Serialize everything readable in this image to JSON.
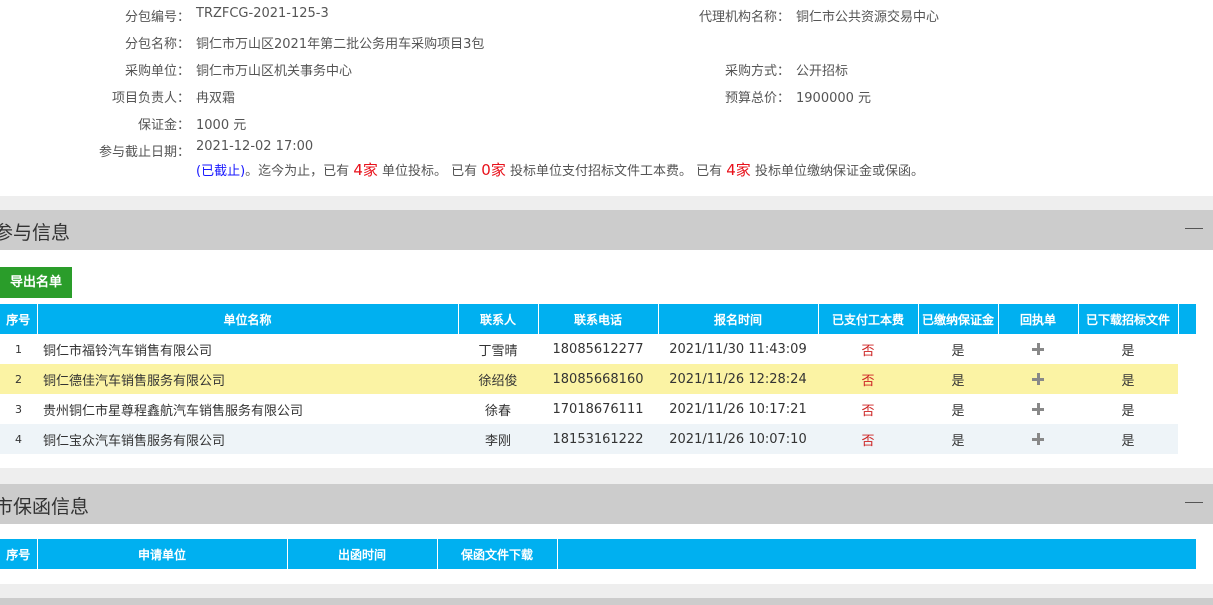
{
  "package_info": {
    "package_no_label": "分包编号：",
    "package_no": "TRZFCG-2021-125-3",
    "agency_label": "代理机构名称：",
    "agency": "铜仁市公共资源交易中心",
    "package_name_label": "分包名称：",
    "package_name": "铜仁市万山区2021年第二批公务用车采购项目3包",
    "purchaser_label": "采购单位：",
    "purchaser": "铜仁市万山区机关事务中心",
    "method_label": "采购方式：",
    "method": "公开招标",
    "manager_label": "项目负责人：",
    "manager": "冉双霜",
    "budget_label": "预算总价：",
    "budget": "1900000 元",
    "deposit_label": "保证金：",
    "deposit": "1000 元",
    "deadline_label": "参与截止日期：",
    "deadline": "2021-12-02 17:00",
    "deadline_status": "(已截止)",
    "stats_text_1": "。迄今为止，已有",
    "bid_count": "4家",
    "stats_text_2": "单位投标。 已有",
    "fee_paid_count": "0家",
    "stats_text_3": "投标单位支付招标文件工本费。 已有",
    "deposit_paid_count": "4家",
    "stats_text_4": "投标单位缴纳保证金或保函。"
  },
  "participants": {
    "title": "参与信息",
    "export_label": "导出名单",
    "columns": [
      "序号",
      "单位名称",
      "联系人",
      "联系电话",
      "报名时间",
      "已支付工本费",
      "已缴纳保证金",
      "回执单",
      "已下载招标文件"
    ],
    "rows": [
      {
        "idx": "1",
        "name": "铜仁市福铃汽车销售有限公司",
        "contact": "丁雪晴",
        "phone": "18085612277",
        "time": "2021/11/30 11:43:09",
        "fee_paid": "否",
        "deposit_paid": "是",
        "downloaded": "是"
      },
      {
        "idx": "2",
        "name": "铜仁德佳汽车销售服务有限公司",
        "contact": "徐绍俊",
        "phone": "18085668160",
        "time": "2021/11/26 12:28:24",
        "fee_paid": "否",
        "deposit_paid": "是",
        "downloaded": "是"
      },
      {
        "idx": "3",
        "name": "贵州铜仁市星尊程鑫航汽车销售服务有限公司",
        "contact": "徐春",
        "phone": "17018676111",
        "time": "2021/11/26 10:17:21",
        "fee_paid": "否",
        "deposit_paid": "是",
        "downloaded": "是"
      },
      {
        "idx": "4",
        "name": "铜仁宝众汽车销售服务有限公司",
        "contact": "李刚",
        "phone": "18153161222",
        "time": "2021/11/26 10:07:10",
        "fee_paid": "否",
        "deposit_paid": "是",
        "downloaded": "是"
      }
    ]
  },
  "guarantees": {
    "title": "市保函信息",
    "columns": [
      "序号",
      "申请单位",
      "出函时间",
      "保函文件下载"
    ]
  },
  "colors": {
    "table_header": "#00b0f0",
    "section_header": "#cccccc",
    "export_button": "#2a9d2a",
    "highlight_row": "#fbf3a4",
    "count_red": "#e8101a",
    "closed_blue": "#1a1aff"
  },
  "icons": {
    "receipt": "plus-icon",
    "collapse": "minus-icon"
  }
}
